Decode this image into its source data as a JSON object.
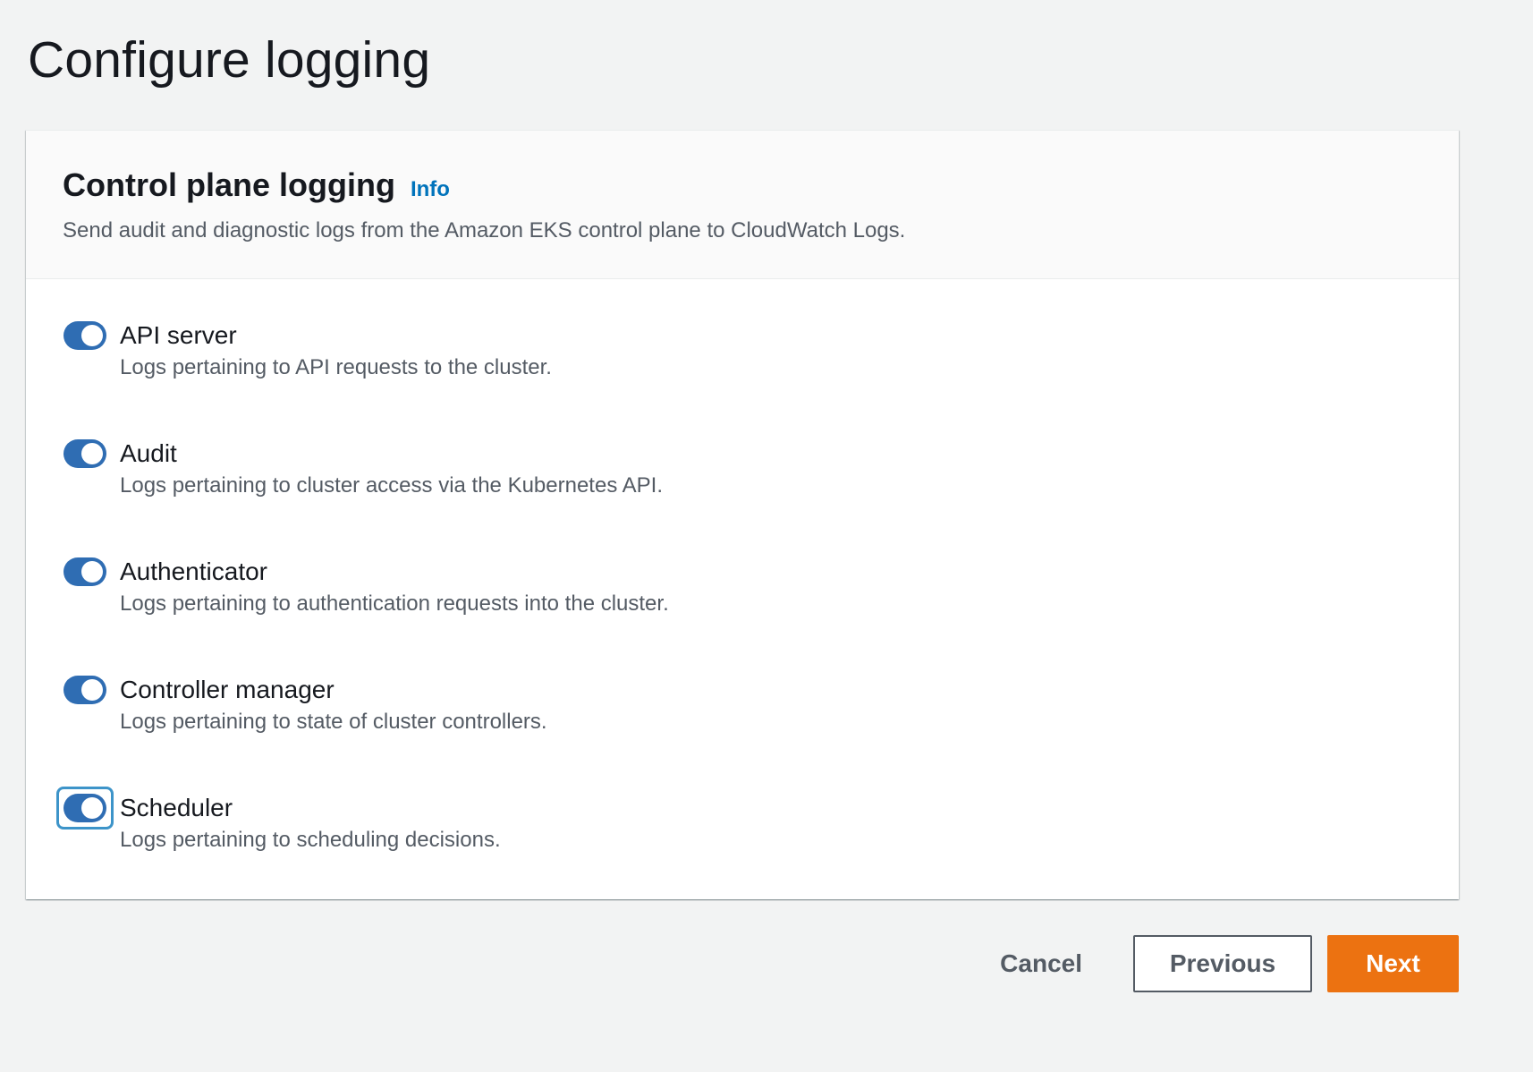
{
  "page": {
    "title": "Configure logging"
  },
  "panel": {
    "title": "Control plane logging",
    "info_link": "Info",
    "description": "Send audit and diagnostic logs from the Amazon EKS control plane to CloudWatch Logs."
  },
  "toggles": [
    {
      "label": "API server",
      "description": "Logs pertaining to API requests to the cluster.",
      "enabled": true,
      "focused": false
    },
    {
      "label": "Audit",
      "description": "Logs pertaining to cluster access via the Kubernetes API.",
      "enabled": true,
      "focused": false
    },
    {
      "label": "Authenticator",
      "description": "Logs pertaining to authentication requests into the cluster.",
      "enabled": true,
      "focused": false
    },
    {
      "label": "Controller manager",
      "description": "Logs pertaining to state of cluster controllers.",
      "enabled": true,
      "focused": false
    },
    {
      "label": "Scheduler",
      "description": "Logs pertaining to scheduling decisions.",
      "enabled": true,
      "focused": true
    }
  ],
  "footer": {
    "cancel_label": "Cancel",
    "previous_label": "Previous",
    "next_label": "Next"
  },
  "colors": {
    "accent_blue": "#2f6db3",
    "link_blue": "#0073bb",
    "primary_orange": "#ec7211",
    "focus_ring": "#3d94c9"
  }
}
